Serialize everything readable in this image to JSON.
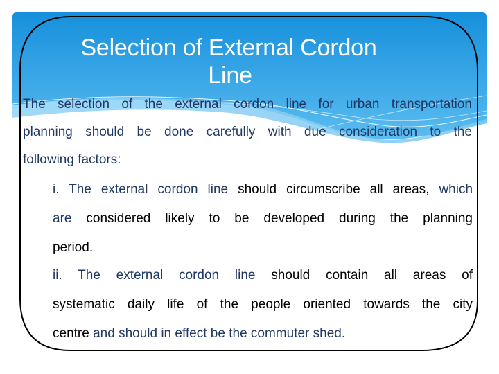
{
  "slide": {
    "title_line1": "Selection of External Cordon",
    "title_line2": "Line",
    "theme_color": "#1a8fd8",
    "text_color_blue": "#1f3864",
    "text_color_black": "#000000",
    "intro": {
      "lines": [
        "The selection of the external cordon line for urban transportation",
        "planning should be done carefully with due consideration to the",
        "following factors:"
      ]
    },
    "factors": [
      {
        "lines": [
          [
            {
              "text": "i. The external cordon line",
              "color": "blue"
            },
            {
              "text": " should circumscribe all areas, ",
              "color": "black"
            },
            {
              "text": "which",
              "color": "blue"
            }
          ],
          [
            {
              "text": "are",
              "color": "blue"
            },
            {
              "text": " considered likely to be developed during the planning",
              "color": "black"
            }
          ],
          [
            {
              "text": "period.",
              "color": "black"
            }
          ]
        ]
      },
      {
        "lines": [
          [
            {
              "text": "ii. The external cordon line",
              "color": "blue"
            },
            {
              "text": " should contain all areas of",
              "color": "black"
            }
          ],
          [
            {
              "text": "systematic daily life of the people oriented towards the city",
              "color": "black"
            }
          ],
          [
            {
              "text": "centre",
              "color": "black"
            },
            {
              "text": " and should in effect be the commuter shed.",
              "color": "blue"
            }
          ]
        ]
      }
    ]
  }
}
